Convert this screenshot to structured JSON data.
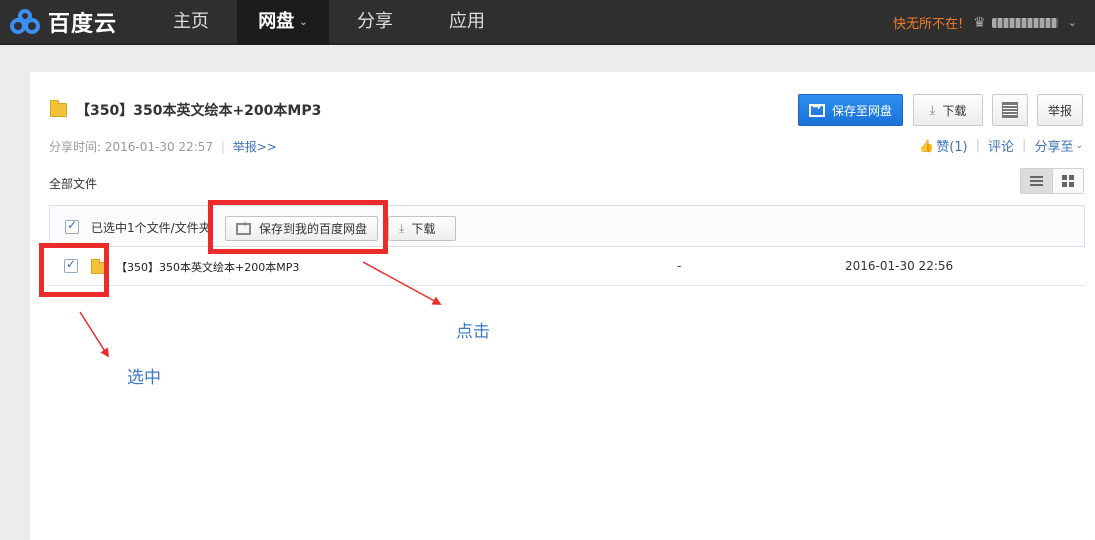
{
  "header": {
    "brand": "百度云",
    "nav": [
      {
        "label": "主页",
        "active": false
      },
      {
        "label": "网盘",
        "active": true
      },
      {
        "label": "分享",
        "active": false
      },
      {
        "label": "应用",
        "active": false
      }
    ],
    "promo": "快无所不在!",
    "nav_chevron": "⌄",
    "crown_icon": "crown-icon"
  },
  "share": {
    "title": "【350】350本英文绘本+200本MP3",
    "meta_label": "分享时间:",
    "meta_time": "2016-01-30 22:57",
    "meta_sep": "|",
    "report_link": "举报>>",
    "save_button": "保存至网盘",
    "download_button": "下载",
    "report_button": "举报",
    "like": "赞(1)",
    "comment": "评论",
    "share_to": "分享至",
    "sep": "|"
  },
  "files": {
    "all_files_label": "全部文件",
    "selection_text": "已选中1个文件/文件夹",
    "save_to_my_button": "保存到我的百度网盘",
    "download_button": "下载",
    "rows": [
      {
        "name": "【350】350本英文绘本+200本MP3",
        "size": "-",
        "date": "2016-01-30 22:56",
        "checked": true
      }
    ]
  },
  "annotations": {
    "click_note": "点击",
    "select_note": "选中",
    "highlight_color": "#ee2b2b"
  },
  "colors": {
    "primary": "#1a72d8",
    "link": "#3d73b8",
    "promo": "#f07a2c"
  }
}
